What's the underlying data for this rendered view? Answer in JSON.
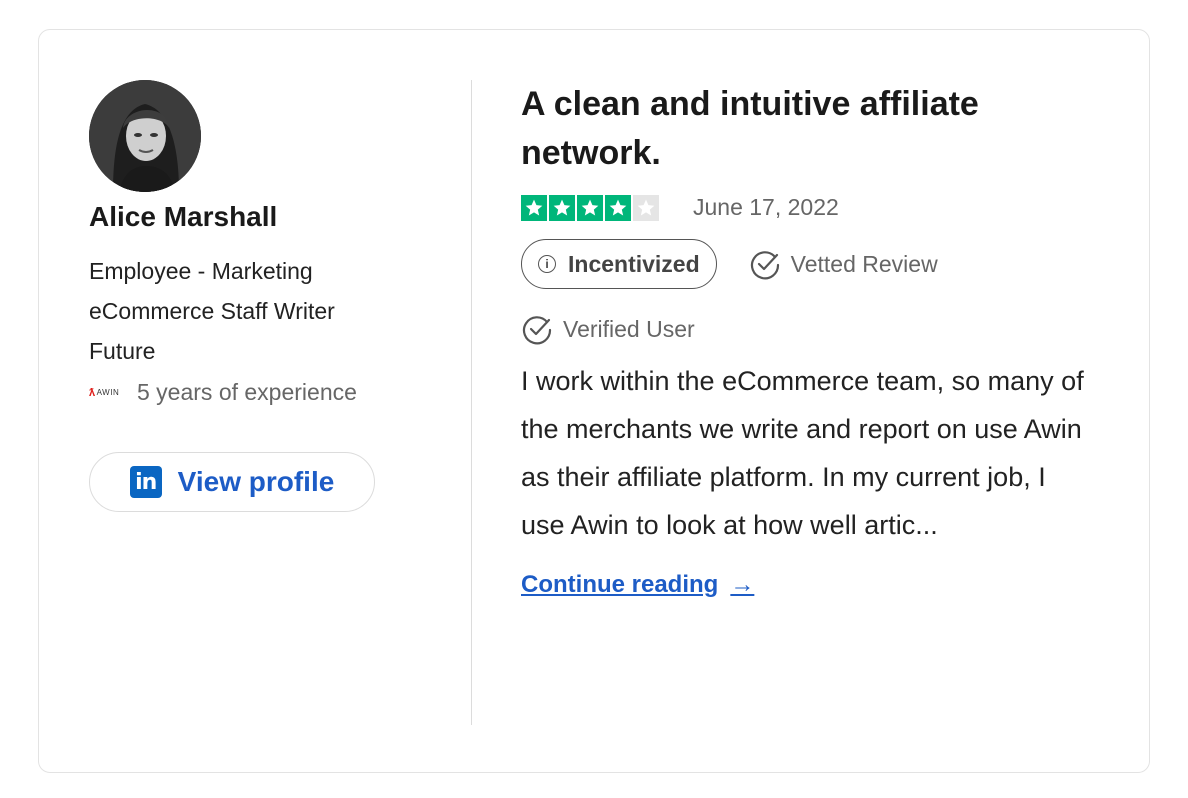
{
  "reviewer": {
    "name": "Alice Marshall",
    "role": "Employee - Marketing",
    "title": "eCommerce Staff Writer",
    "company": "Future",
    "experience": "5 years of experience",
    "company_logo_text": "AWIN",
    "view_profile_label": "View profile",
    "linkedin_icon_text": "in"
  },
  "review": {
    "title": "A clean and intuitive affiliate network.",
    "rating": 4,
    "rating_max": 5,
    "date": "June 17, 2022",
    "incentivized_label": "Incentivized",
    "vetted_label": "Vetted Review",
    "verified_label": "Verified User",
    "body": "I work within the eCommerce team, so many of the merchants we write and report on use Awin as their affiliate platform. In my current job, I use Awin to look at how well artic...",
    "continue_label": "Continue reading",
    "continue_arrow": "→"
  },
  "colors": {
    "star_filled": "#00b67a",
    "star_empty": "#e5e5e5",
    "link": "#1d5cc6",
    "linkedin": "#0a66c2"
  },
  "icons": {
    "linkedin": "linkedin-icon",
    "info": "info-icon",
    "check_circle": "check-circle-icon",
    "arrow": "arrow-right-icon"
  }
}
